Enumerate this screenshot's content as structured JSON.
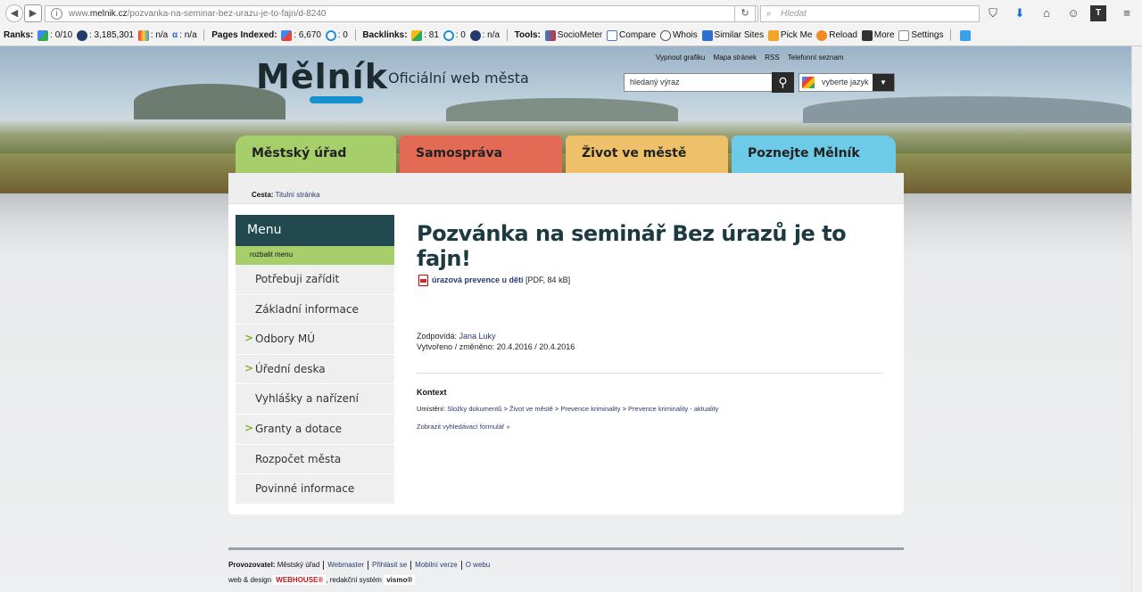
{
  "browser": {
    "url_prefix": "www.",
    "url_domain": "melnik.cz",
    "url_path": "/pozvanka-na-seminar-bez-urazu-je-to-fajn/d-8240",
    "search_placeholder": "Hledat",
    "back_icon": "back-icon",
    "forward_icon": "forward-icon"
  },
  "seobar": {
    "ranks_label": "Ranks:",
    "pr": ": 0/10",
    "alexa": ": 3,185,301",
    "majestic": ": n/a",
    "alpha": ": n/a",
    "pages_indexed_label": "Pages Indexed:",
    "pi_google": ": 6,670",
    "pi_bing": ": 0",
    "backlinks_label": "Backlinks:",
    "bl_google": ": 81",
    "bl_bing": ": 0",
    "bl_other": ": n/a",
    "tools_label": "Tools:",
    "sociometer": "SocioMeter",
    "compare": "Compare",
    "whois": "Whois",
    "similar": "Similar Sites",
    "pickme": "Pick Me",
    "reload": "Reload",
    "more": "More",
    "settings": "Settings"
  },
  "header": {
    "logo": "Mělník",
    "tagline": "Oficiální web města",
    "links": [
      "Vypnout grafiku",
      "Mapa stránek",
      "RSS",
      "Telefonní seznam"
    ],
    "search_value": "hledaný výraz",
    "lang_label": "vyberte jazyk"
  },
  "tabs": [
    {
      "label": "Městský úřad",
      "color": "#a6cf6b"
    },
    {
      "label": "Samospráva",
      "color": "#e36b55"
    },
    {
      "label": "Život ve městě",
      "color": "#eec06a"
    },
    {
      "label": "Poznejte Mělník",
      "color": "#6dcbe8"
    }
  ],
  "breadcrumb": {
    "label": "Cesta:",
    "link": "Titulní stránka"
  },
  "menu": {
    "title": "Menu",
    "expand_link": "rozbalit",
    "expand_text": " menu",
    "items": [
      {
        "label": "Potřebuji zařídit",
        "arrow": ""
      },
      {
        "label": "Základní informace",
        "arrow": ""
      },
      {
        "label": "Odbory MÚ",
        "arrow": ">"
      },
      {
        "label": "Úřední deska",
        "arrow": ">"
      },
      {
        "label": "Vyhlášky a nařízení",
        "arrow": ""
      },
      {
        "label": "Granty a dotace",
        "arrow": ">"
      },
      {
        "label": "Rozpočet města",
        "arrow": ""
      },
      {
        "label": "Povinné informace",
        "arrow": ""
      }
    ]
  },
  "article": {
    "title": "Pozvánka na seminář Bez úrazů je to fajn!",
    "attachment_link": "úrazová prevence u dětí",
    "attachment_meta": " [PDF, 84 kB]",
    "responsible_label": "Zodpovídá: ",
    "responsible_name": "Jana Luky",
    "dates": "Vytvořeno / změněno: 20.4.2016 / 20.4.2016",
    "context_title": "Kontext",
    "location_label": "Umístění: ",
    "location_path": [
      "Složky dokumentů",
      "Život ve městě",
      "Prevence kriminality",
      "Prevence kriminality - aktuality"
    ],
    "search_form_link": "Zobrazit vyhledávací formulář »"
  },
  "footer": {
    "operator_label": "Provozovatel:",
    "operator": " Městský úřad",
    "links": [
      "Webmaster",
      "Přihlásit se",
      "Mobilní verze",
      "O webu"
    ],
    "design_text": "web & design",
    "webhouse": "WEBHOUSE®",
    "system_text": ", redakční systém",
    "vismo": "vismo®"
  }
}
